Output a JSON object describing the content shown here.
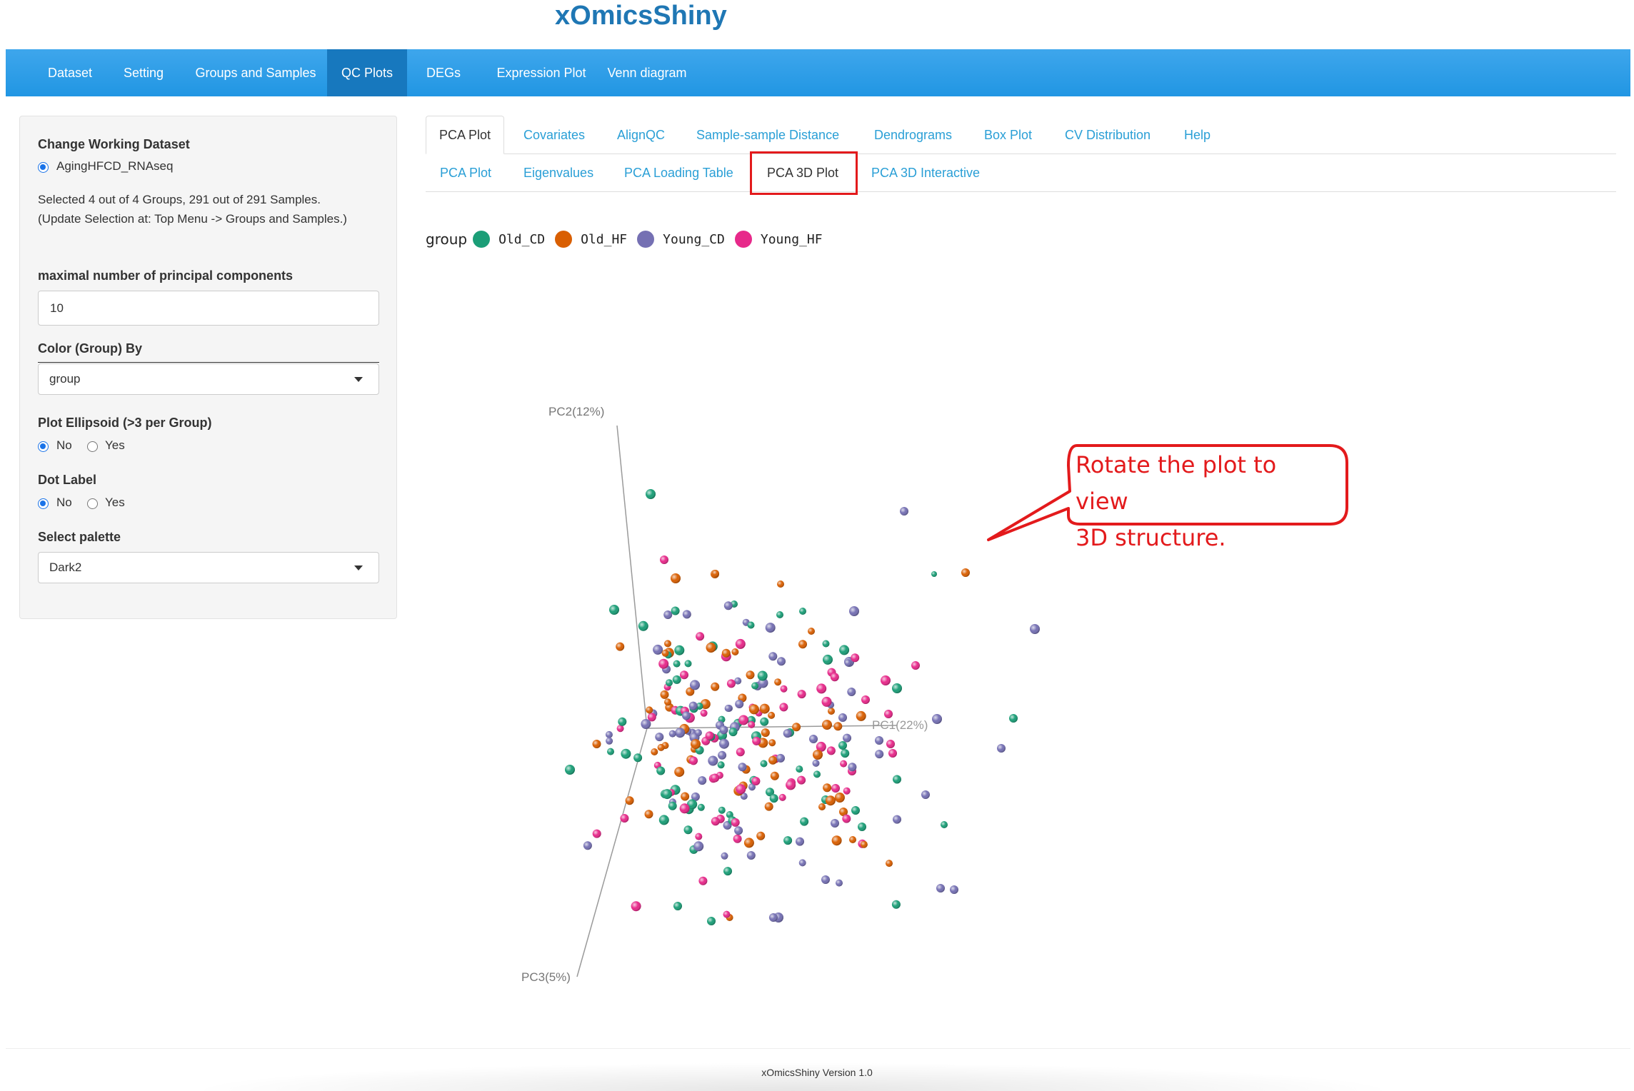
{
  "app": {
    "title": "xOmicsShiny"
  },
  "navbar": {
    "items": [
      {
        "label": "Dataset",
        "active": false
      },
      {
        "label": "Setting",
        "active": false
      },
      {
        "label": "Groups and Samples",
        "active": false
      },
      {
        "label": "QC Plots",
        "active": true
      },
      {
        "label": "DEGs",
        "active": false
      },
      {
        "label": "Expression Plot",
        "active": false
      },
      {
        "label": "Venn diagram",
        "active": false
      }
    ]
  },
  "sidebar": {
    "dataset_heading": "Change Working Dataset",
    "dataset_option": "AgingHFCD_RNAseq",
    "selection_line1": "Selected 4 out of 4 Groups, 291 out of 291 Samples.",
    "selection_line2": "(Update Selection at: Top Menu -> Groups and Samples.)",
    "pc_label": "maximal number of principal components",
    "pc_value": "10",
    "color_label": "Color (Group) By",
    "color_value": "group",
    "ellipsoid_label": "Plot Ellipsoid (>3 per Group)",
    "ellipsoid_options": [
      "No",
      "Yes"
    ],
    "ellipsoid_selected": "No",
    "dotlabel_label": "Dot Label",
    "dotlabel_options": [
      "No",
      "Yes"
    ],
    "dotlabel_selected": "No",
    "palette_label": "Select palette",
    "palette_value": "Dark2"
  },
  "tabs": {
    "top": [
      "PCA Plot",
      "Covariates",
      "AlignQC",
      "Sample-sample Distance",
      "Dendrograms",
      "Box Plot",
      "CV Distribution",
      "Help"
    ],
    "top_active": "PCA Plot",
    "sub": [
      "PCA Plot",
      "Eigenvalues",
      "PCA Loading Table",
      "PCA 3D Plot",
      "PCA 3D Interactive"
    ],
    "sub_active": "PCA 3D Plot"
  },
  "legend": {
    "title": "group",
    "entries": [
      {
        "name": "Old_CD",
        "color": "#1b9e77"
      },
      {
        "name": "Old_HF",
        "color": "#d95f02"
      },
      {
        "name": "Young_CD",
        "color": "#7570b3"
      },
      {
        "name": "Young_HF",
        "color": "#e7298a"
      }
    ]
  },
  "chart_data": {
    "type": "scatter",
    "title": "",
    "axes": {
      "x": "PC1(22%)",
      "y": "PC2(12%)",
      "z": "PC3(5%)"
    },
    "note": "3D PCA scatter of 291 samples projected on screen; grid off; legend top-left",
    "series": [
      {
        "name": "Old_CD",
        "color": "#1b9e77"
      },
      {
        "name": "Old_HF",
        "color": "#d95f02"
      },
      {
        "name": "Young_CD",
        "color": "#7570b3"
      },
      {
        "name": "Young_HF",
        "color": "#e7298a"
      }
    ]
  },
  "callout": {
    "line1": "Rotate the plot to view",
    "line2": "3D structure.",
    "color": "#e31a1c"
  },
  "footer": {
    "text": "xOmicsShiny Version 1.0"
  }
}
